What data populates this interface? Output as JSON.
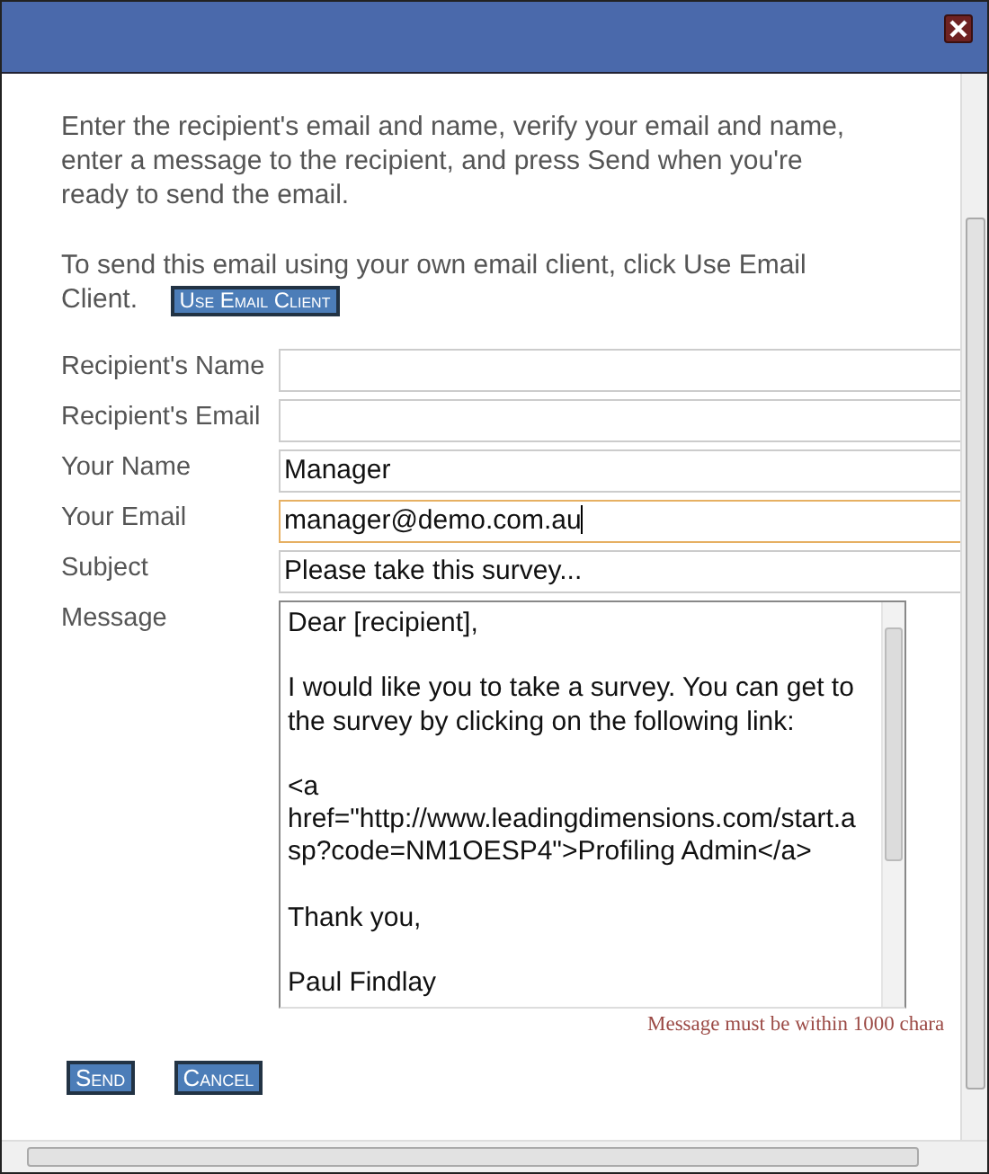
{
  "instructions": "Enter the recipient's email and name, verify your email and name, enter a message to the recipient, and press Send when you're ready to send the email.",
  "client_note": [
    "To send this email using your own email client, click Use Email",
    "Client."
  ],
  "use_email_client_button": "Use Email Client",
  "fields": [
    {
      "label": "Recipient's Name",
      "focused": false
    },
    {
      "label": "Recipient's Email",
      "focused": false
    },
    {
      "label": "Your Name",
      "value": "Manager",
      "focused": false
    },
    {
      "label": "Your Email",
      "value": "manager@demo.com.au",
      "focused": true
    },
    {
      "label": "Subject",
      "value": "Please take this survey...",
      "focused": false
    }
  ],
  "message": {
    "label": "Message",
    "paragraphs": [
      [
        "Dear [recipient],"
      ],
      [
        "I would like you to take a survey. You can get to",
        "the survey by clicking on the following link:"
      ],
      [
        "<a",
        "href=\"http://www.leadingdimensions.com/start.a",
        "sp?code=NM1OESP4\">Profiling Admin</a>"
      ],
      [
        "Thank you,"
      ],
      [
        "Paul Findlay"
      ]
    ],
    "validation": "Message must be within 1000 chara"
  },
  "buttons": [
    "Send",
    "Cancel"
  ]
}
